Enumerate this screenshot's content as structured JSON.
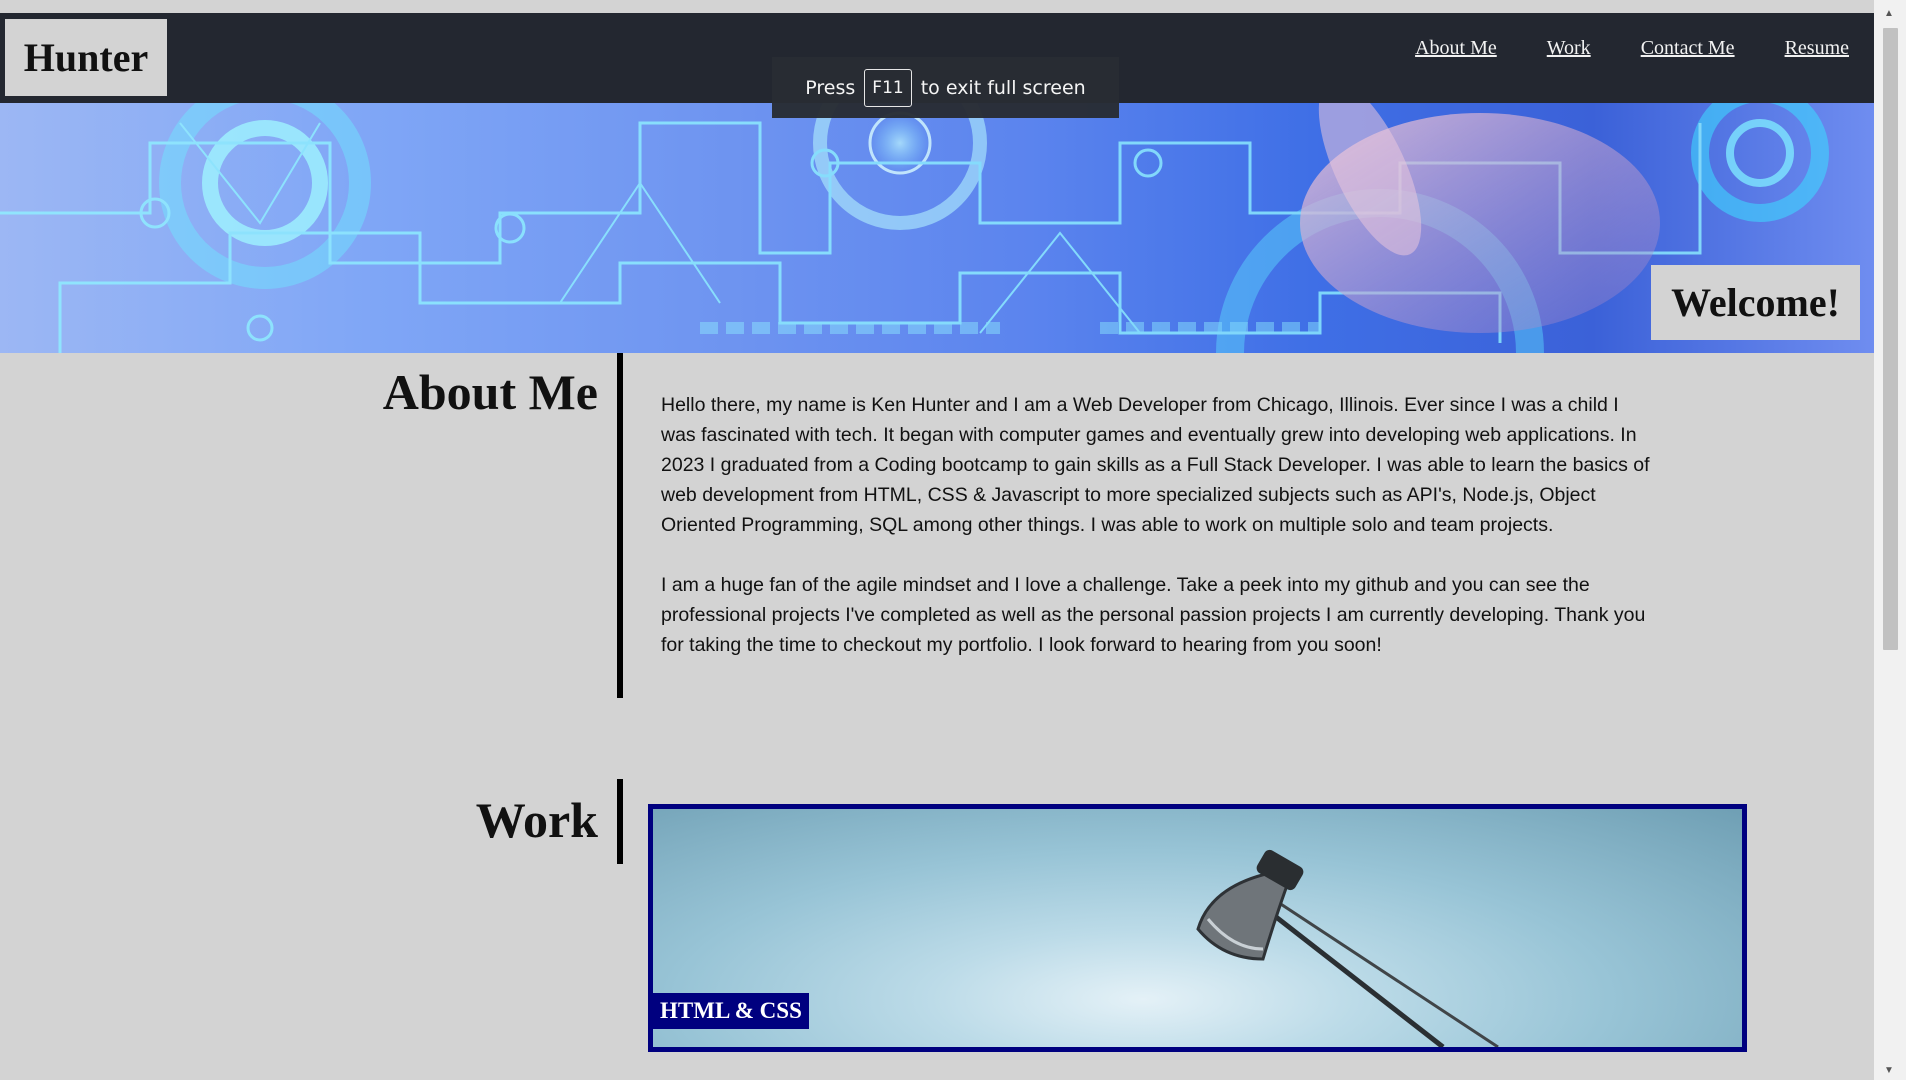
{
  "header": {
    "logo": "Hunter",
    "nav": [
      "About Me",
      "Work",
      "Contact Me",
      "Resume"
    ]
  },
  "fullscreen_notice": {
    "before": "Press",
    "key": "F11",
    "after": "to exit full screen"
  },
  "hero": {
    "welcome": "Welcome!"
  },
  "about": {
    "title": "About Me",
    "paragraphs": [
      "Hello there, my name is Ken Hunter and I am a Web Developer from Chicago, Illinois. Ever since I was a child I was fascinated with tech. It began with computer games and eventually grew into developing web applications. In 2023 I graduated from a Coding bootcamp to gain skills as a Full Stack Developer. I was able to learn the basics of web development from HTML, CSS & Javascript to more specialized subjects such as API's, Node.js, Object Oriented Programming, SQL among other things. I was able to work on multiple solo and team projects.",
      "I am a huge fan of the agile mindset and I love a challenge. Take a peek into my github and you can see the professional projects I've completed as well as the personal passion projects I am currently developing. Thank you for taking the time to checkout my portfolio. I look forward to hearing from you soon!"
    ]
  },
  "work": {
    "title": "Work",
    "projects": [
      {
        "label": "HTML & CSS"
      }
    ]
  },
  "colors": {
    "header_bg": "#232730",
    "page_bg": "#d3d3d3",
    "card_border": "#00007f"
  }
}
